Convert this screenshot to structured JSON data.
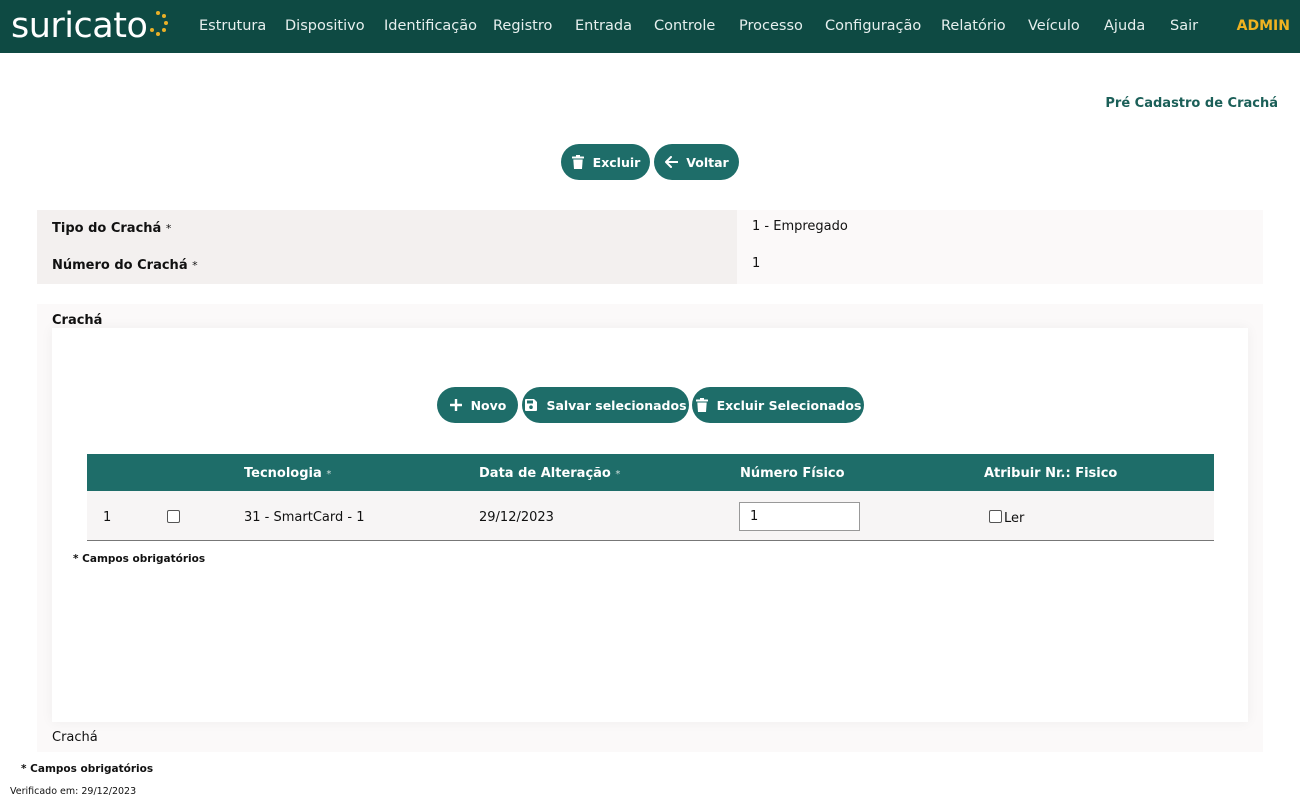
{
  "brand": {
    "name": "suricato",
    "accent_color": "#e9b027",
    "bar_color": "#0e4a43"
  },
  "nav": {
    "items": [
      "Estrutura",
      "Dispositivo",
      "Identificação",
      "Registro",
      "Entrada",
      "Controle",
      "Processo",
      "Configuração",
      "Relatório",
      "Veículo",
      "Ajuda",
      "Sair"
    ],
    "user": "ADMIN"
  },
  "page": {
    "title": "Pré Cadastro de Crachá"
  },
  "actions": {
    "delete_label": "Excluir",
    "back_label": "Voltar"
  },
  "form": {
    "tipo_label": "Tipo do Crachá",
    "tipo_value": "1 - Empregado",
    "numero_label": "Número do Crachá",
    "numero_value": "1",
    "required_mark": "*"
  },
  "section": {
    "title": "Crachá",
    "footer": "Crachá",
    "buttons": {
      "new_label": "Novo",
      "save_selected_label": "Salvar selecionados",
      "delete_selected_label": "Excluir Selecionados"
    }
  },
  "table": {
    "headers": {
      "tecnologia": "Tecnologia",
      "data": "Data de Alteração",
      "numero_fisico": "Número Físico",
      "atribuir": "Atribuir Nr.: Fisico"
    },
    "rows": [
      {
        "index": "1",
        "selected": false,
        "tecnologia": "31 - SmartCard - 1",
        "data": "29/12/2023",
        "numero_fisico": "1",
        "ler_label": "Ler",
        "ler_checked": false
      }
    ]
  },
  "notes": {
    "required_inner": "* Campos obrigatórios",
    "required_outer": "* Campos obrigatórios"
  },
  "footer": {
    "verified": "Verificado em: 29/12/2023"
  },
  "icons": {
    "delete": "trash-icon",
    "back": "arrow-left-icon",
    "new": "plus-icon",
    "save": "floppy-disk-icon"
  }
}
